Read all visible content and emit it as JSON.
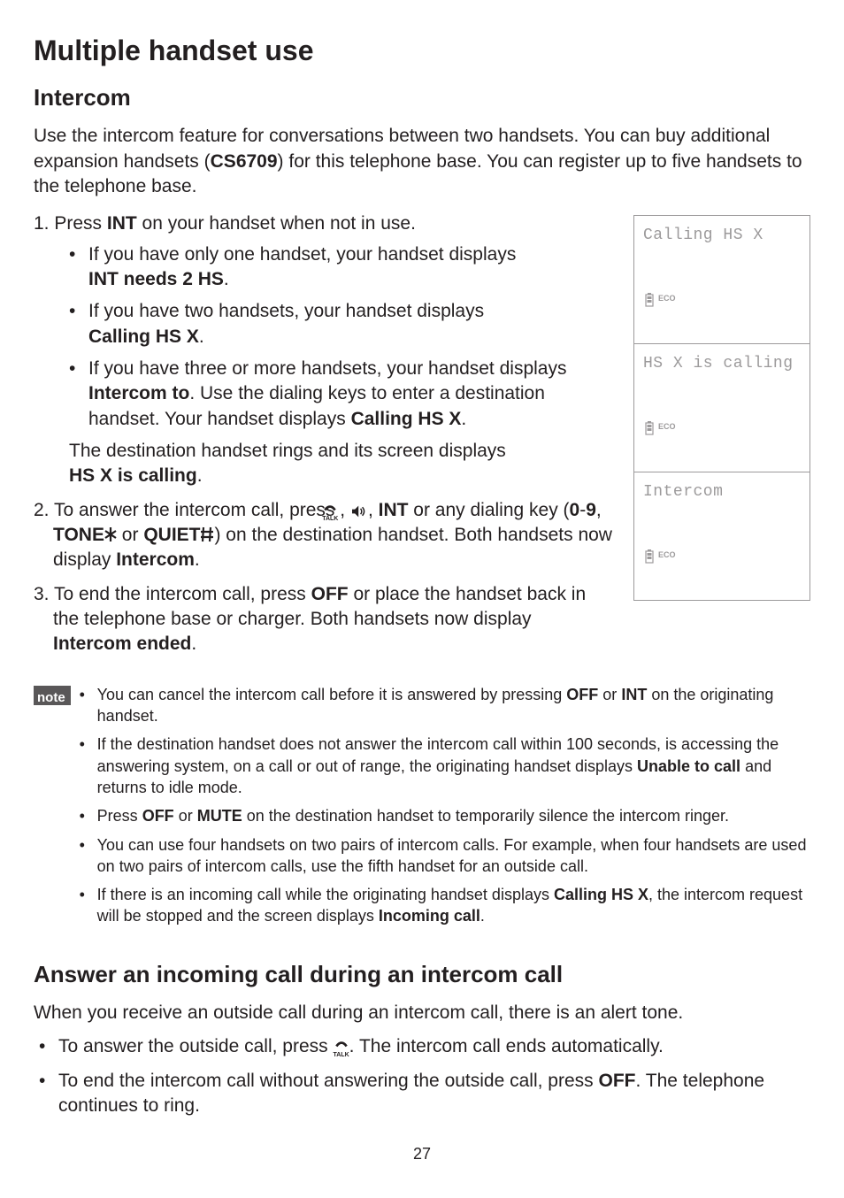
{
  "title": "Multiple handset use",
  "intercom": {
    "heading": "Intercom",
    "intro_pre": "Use the intercom feature for conversations between two handsets. You can buy additional expansion handsets (",
    "intro_model": "CS6709",
    "intro_post": ") for this telephone base. You can register up to five handsets to the telephone base.",
    "step1_lead": "1. Press ",
    "step1_int": "INT",
    "step1_tail": " on your handset when not in use.",
    "s1b1_pre": "If you have only one handset, your handset displays ",
    "s1b1_bold": "INT needs 2 HS",
    "s1b2_pre": "If you have two handsets, your handset displays ",
    "s1b2_bold": "Calling HS X",
    "s1b3_pre": "If you have three or more handsets, your handset displays ",
    "s1b3_bold1": "Intercom to",
    "s1b3_mid": ". Use the dialing keys to enter a destination handset. Your handset displays ",
    "s1b3_bold2": "Calling HS X",
    "s1_follow_pre": "The destination handset rings and its screen displays ",
    "s1_follow_bold": "HS X is calling",
    "step2_num": "2. ",
    "step2_a": "To answer the intercom call, press ",
    "step2_comma": ", ",
    "step2_int": "INT",
    "step2_b": " or any dialing key (",
    "step2_keys09": "0",
    "step2_dash": "-",
    "step2_keys9": "9",
    "step2_c1": ", ",
    "step2_tone": "TONE",
    "step2_or": " or ",
    "step2_quiet": "QUIET",
    "step2_c": ") on the destination handset. Both handsets now display ",
    "step2_bold": "Intercom",
    "step3_num": "3. ",
    "step3_a": "To end the intercom call, press ",
    "step3_off": "OFF",
    "step3_b": " or place the handset back in the telephone base or charger. Both handsets now display ",
    "step3_bold": "Intercom ended"
  },
  "screens": {
    "s1": "Calling HS X",
    "s2": "HS X is calling",
    "s3": "Intercom",
    "eco": "ECO"
  },
  "note": {
    "label": "note",
    "n1a": "You can cancel the intercom call before it is answered by pressing ",
    "n1_off": "OFF",
    "n1b": " or ",
    "n1_int": "INT",
    "n1c": " on the originating handset.",
    "n2a": "If the destination handset does not answer the intercom call within 100 seconds, is accessing the answering system, on a call or out of range, the originating handset displays ",
    "n2_bold": "Unable to call",
    "n2b": " and returns to idle mode.",
    "n3a": "Press ",
    "n3_off": "OFF",
    "n3b": " or ",
    "n3_mute": "MUTE",
    "n3c": " on the destination handset to temporarily silence the intercom ringer.",
    "n4": "You can use four handsets on two pairs of intercom calls. For example, when four handsets are used on two pairs of intercom calls, use the fifth handset for an outside call.",
    "n5a": "If there is an incoming call while the originating handset displays ",
    "n5_bold1": "Calling HS X",
    "n5b": ", the intercom request will be stopped and the screen displays ",
    "n5_bold2": "Incoming call"
  },
  "answer": {
    "heading": "Answer an incoming call during an intercom call",
    "intro": "When you receive an outside call during an intercom call, there is an alert tone.",
    "b1a": "To answer the outside call, press ",
    "b1b": ". The intercom call ends automatically.",
    "b2a": "To end the intercom call without answering the outside call, press ",
    "b2_off": "OFF",
    "b2b": ". The telephone continues to ring."
  },
  "page_number": "27"
}
